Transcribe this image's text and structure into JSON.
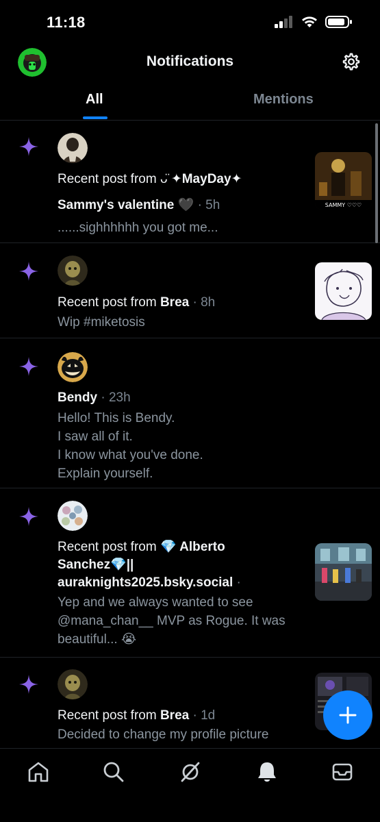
{
  "status": {
    "time": "11:18"
  },
  "header": {
    "title": "Notifications"
  },
  "tabs": [
    {
      "label": "All"
    },
    {
      "label": "Mentions"
    }
  ],
  "notifications": [
    {
      "prefix": "Recent post from ",
      "author": "✦MayDay✦",
      "post_title": "Sammy's valentine",
      "post_title_emoji": "🖤",
      "time": "· 5h",
      "snippet": "......sighhhhhh you got me...",
      "thumb_caption": "SAMMY ♡♡♡"
    },
    {
      "prefix": "Recent post from ",
      "author": "Brea",
      "time": " · 8h",
      "snippet": "Wip #miketosis"
    },
    {
      "author": "Bendy",
      "time": " · 23h",
      "lines": [
        "Hello! This is Bendy.",
        "I saw all of it.",
        "I know what you've done.",
        "Explain yourself."
      ]
    },
    {
      "prefix": "Recent post from ",
      "author_line1": "💎 Alberto",
      "author_line2": "Sanchez💎||",
      "author_line3": "auraknights2025.bsky.social",
      "time": " ·",
      "lines": [
        "Yep and we always wanted to see",
        "@mana_chan__ MVP as Rogue. It was",
        "beautiful... 😭"
      ]
    },
    {
      "prefix": "Recent post from ",
      "author": "Brea",
      "time": " · 1d",
      "snippet": "Decided to change my profile picture"
    }
  ]
}
